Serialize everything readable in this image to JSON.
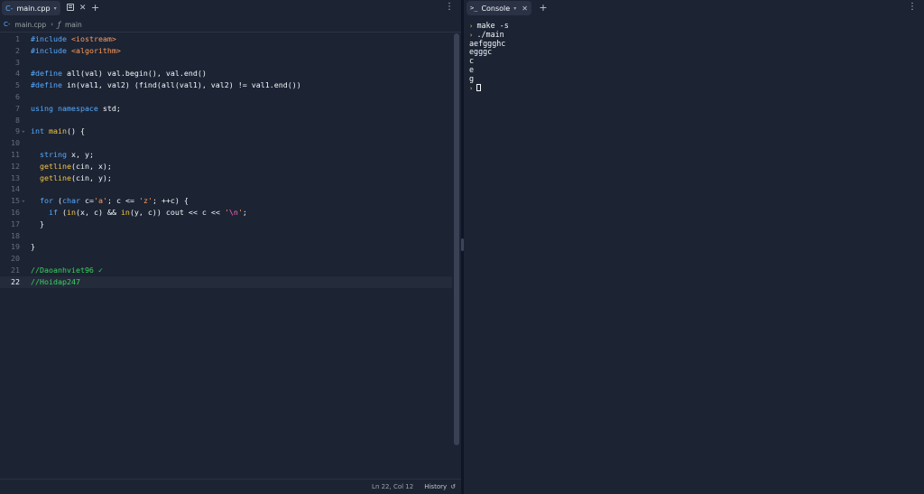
{
  "editor_tab": {
    "label": "main.cpp",
    "icon": "cpp-file-icon"
  },
  "breadcrumb": {
    "file": "main.cpp",
    "symbol": "main"
  },
  "code_lines": [
    {
      "n": "1",
      "html": "<span class=\"kw\">#include</span> <span class=\"inc\">&lt;iostream&gt;</span>"
    },
    {
      "n": "2",
      "html": "<span class=\"kw\">#include</span> <span class=\"inc\">&lt;algorithm&gt;</span>"
    },
    {
      "n": "3",
      "html": ""
    },
    {
      "n": "4",
      "html": "<span class=\"kw\">#define</span> all(val) val.begin(), val.end()"
    },
    {
      "n": "5",
      "html": "<span class=\"kw\">#define</span> in(val1, val2) (find(all(val1), val2) != val1.end())"
    },
    {
      "n": "6",
      "html": ""
    },
    {
      "n": "7",
      "html": "<span class=\"kw\">using namespace</span> std;"
    },
    {
      "n": "8",
      "html": ""
    },
    {
      "n": "9",
      "html": "<span class=\"kw\">int</span> <span class=\"fnc\">main</span>() {",
      "fold": true
    },
    {
      "n": "10",
      "html": ""
    },
    {
      "n": "11",
      "html": "  <span class=\"kw\">string</span> x, y;"
    },
    {
      "n": "12",
      "html": "  <span class=\"fnc\">getline</span>(cin, x);"
    },
    {
      "n": "13",
      "html": "  <span class=\"fnc\">getline</span>(cin, y);"
    },
    {
      "n": "14",
      "html": ""
    },
    {
      "n": "15",
      "html": "  <span class=\"kw\">for</span> (<span class=\"kw\">char</span> c=<span class=\"str\">'a'</span>; c &lt;= <span class=\"str\">'z'</span>; ++c) {",
      "fold": true
    },
    {
      "n": "16",
      "html": "    <span class=\"kw\">if</span> (<span class=\"fnc\">in</span>(x, c) &amp;&amp; <span class=\"fnc\">in</span>(y, c)) cout &lt;&lt; c &lt;&lt; <span class=\"str\">'</span><span class=\"esc\">\\n</span><span class=\"str\">'</span>;"
    },
    {
      "n": "17",
      "html": "  }"
    },
    {
      "n": "18",
      "html": ""
    },
    {
      "n": "19",
      "html": "}"
    },
    {
      "n": "20",
      "html": ""
    },
    {
      "n": "21",
      "html": "<span class=\"cmt\">//Daoanhviet96 ✓</span>"
    },
    {
      "n": "22",
      "html": "<span class=\"cmt\">//Hoidap247</span>",
      "active": true
    }
  ],
  "status": {
    "position": "Ln 22, Col 12",
    "history": "History"
  },
  "console_tab": {
    "label": "Console",
    "icon": "terminal-icon"
  },
  "console_lines": [
    {
      "prompt": true,
      "text": "make -s"
    },
    {
      "prompt": true,
      "text": "./main"
    },
    {
      "prompt": false,
      "text": "aefggghc"
    },
    {
      "prompt": false,
      "text": "egggc"
    },
    {
      "prompt": false,
      "text": "c"
    },
    {
      "prompt": false,
      "text": "e"
    },
    {
      "prompt": false,
      "text": "g"
    },
    {
      "prompt": true,
      "text": "",
      "cursor": true
    }
  ]
}
